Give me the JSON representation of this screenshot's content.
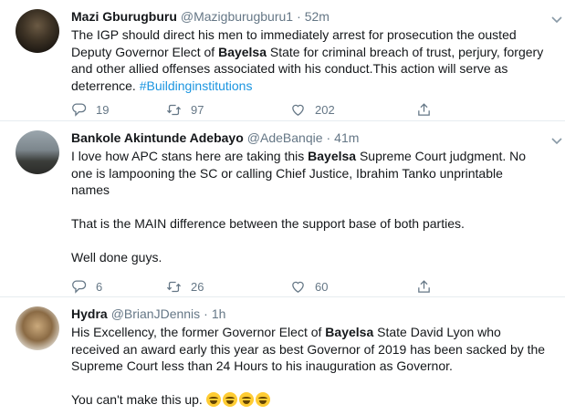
{
  "tweets": [
    {
      "name": "Mazi Gburugburu",
      "handle": "@Mazigburugburu1",
      "time": "52m",
      "text_parts": [
        {
          "t": "The IGP should direct his men to immediately arrest for prosecution the ousted\nDeputy Governor Elect of "
        },
        {
          "t": "Bayelsa",
          "b": true
        },
        {
          "t": " State for criminal breach of trust, perjury, forgery\nand other allied offenses associated with his conduct.This action will serve as\ndeterrence. "
        },
        {
          "t": "#Buildinginstitutions",
          "link": true
        }
      ],
      "replies": "19",
      "retweets": "97",
      "likes": "202"
    },
    {
      "name": "Bankole Akintunde Adebayo",
      "handle": "@AdeBanqie",
      "time": "41m",
      "text_parts": [
        {
          "t": "I love how APC stans here are taking this "
        },
        {
          "t": "Bayelsa",
          "b": true
        },
        {
          "t": " Supreme Court judgment. No\none is lampooning the SC or calling Chief Justice, Ibrahim Tanko unprintable\nnames\n\nThat is the MAIN difference between the support base of both parties.\n\nWell done guys."
        }
      ],
      "replies": "6",
      "retweets": "26",
      "likes": "60"
    },
    {
      "name": "Hydra",
      "handle": "@BrianJDennis",
      "time": "1h",
      "text_parts": [
        {
          "t": "His Excellency, the former Governor Elect of "
        },
        {
          "t": "Bayelsa",
          "b": true
        },
        {
          "t": " State David Lyon who\nreceived an award early this year as best Governor of 2019 has been sacked by the\nSupreme Court less than 24 Hours to his inauguration as Governor.\n\nYou can't make this up. "
        }
      ],
      "emoji_count": 4,
      "emoji_name": "laughing-tears-emoji"
    }
  ],
  "icons": {
    "reply": "reply-icon",
    "retweet": "retweet-icon",
    "like": "heart-icon",
    "share": "share-icon",
    "caret": "chevron-down-icon"
  },
  "colors": {
    "link": "#1b95e0",
    "secondary": "#657786",
    "divider": "#e6ecf0"
  }
}
